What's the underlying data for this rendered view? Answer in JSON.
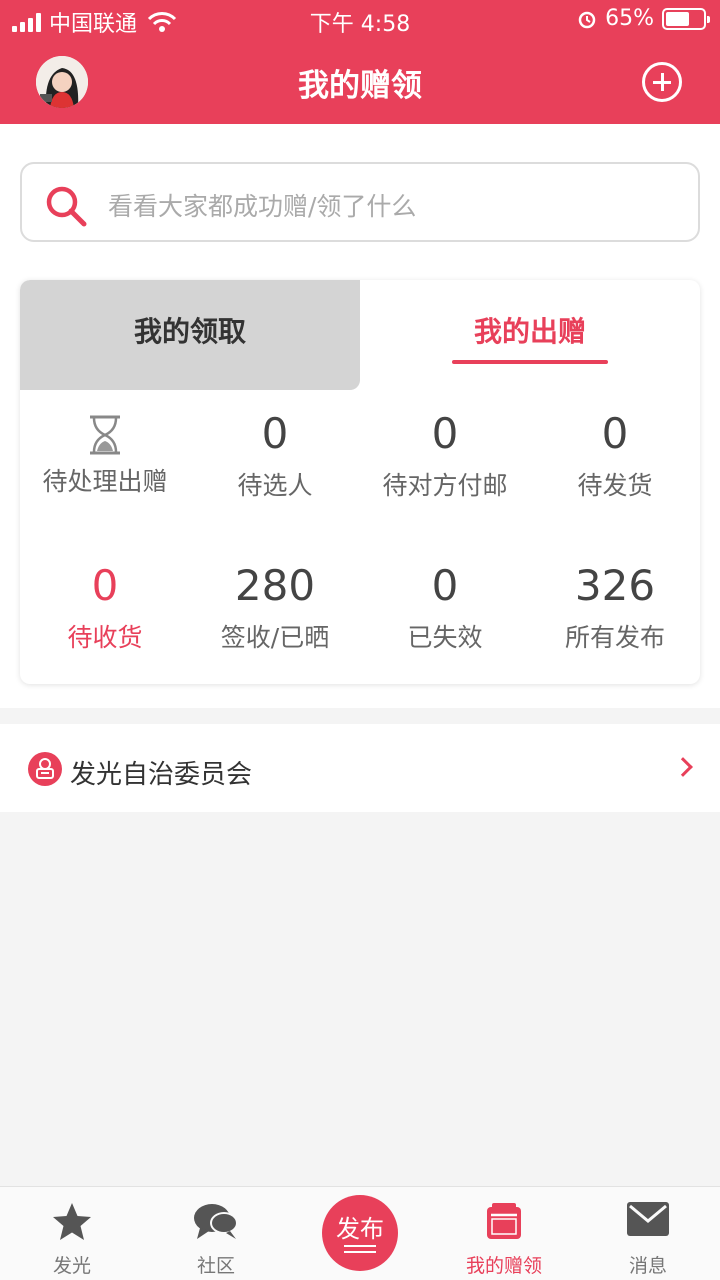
{
  "status_bar": {
    "carrier": "中国联通",
    "time": "下午 4:58",
    "battery": "65%"
  },
  "header": {
    "title": "我的赠领"
  },
  "search": {
    "placeholder": "看看大家都成功赠/领了什么"
  },
  "tabs": {
    "left": "我的领取",
    "right": "我的出赠",
    "active": "right"
  },
  "stats": [
    {
      "value": "",
      "label": "待处理出赠",
      "icon": "hourglass-icon"
    },
    {
      "value": "0",
      "label": "待选人"
    },
    {
      "value": "0",
      "label": "待对方付邮"
    },
    {
      "value": "0",
      "label": "待发货"
    },
    {
      "value": "0",
      "label": "待收货",
      "highlight": true
    },
    {
      "value": "280",
      "label": "签收/已晒"
    },
    {
      "value": "0",
      "label": "已失效"
    },
    {
      "value": "326",
      "label": "所有发布"
    }
  ],
  "committee": {
    "label": "发光自治委员会"
  },
  "tabbar": {
    "items": [
      {
        "label": "发光",
        "icon": "star-icon"
      },
      {
        "label": "社区",
        "icon": "chat-bubble-icon"
      },
      {
        "label": "发布",
        "icon": "publish-button"
      },
      {
        "label": "我的赠领",
        "icon": "gift-box-icon",
        "active": true
      },
      {
        "label": "消息",
        "icon": "mail-icon"
      }
    ]
  },
  "colors": {
    "accent": "#e8405a",
    "tab_inactive_bg": "#d4d4d4",
    "page_bg": "#f4f4f4"
  }
}
